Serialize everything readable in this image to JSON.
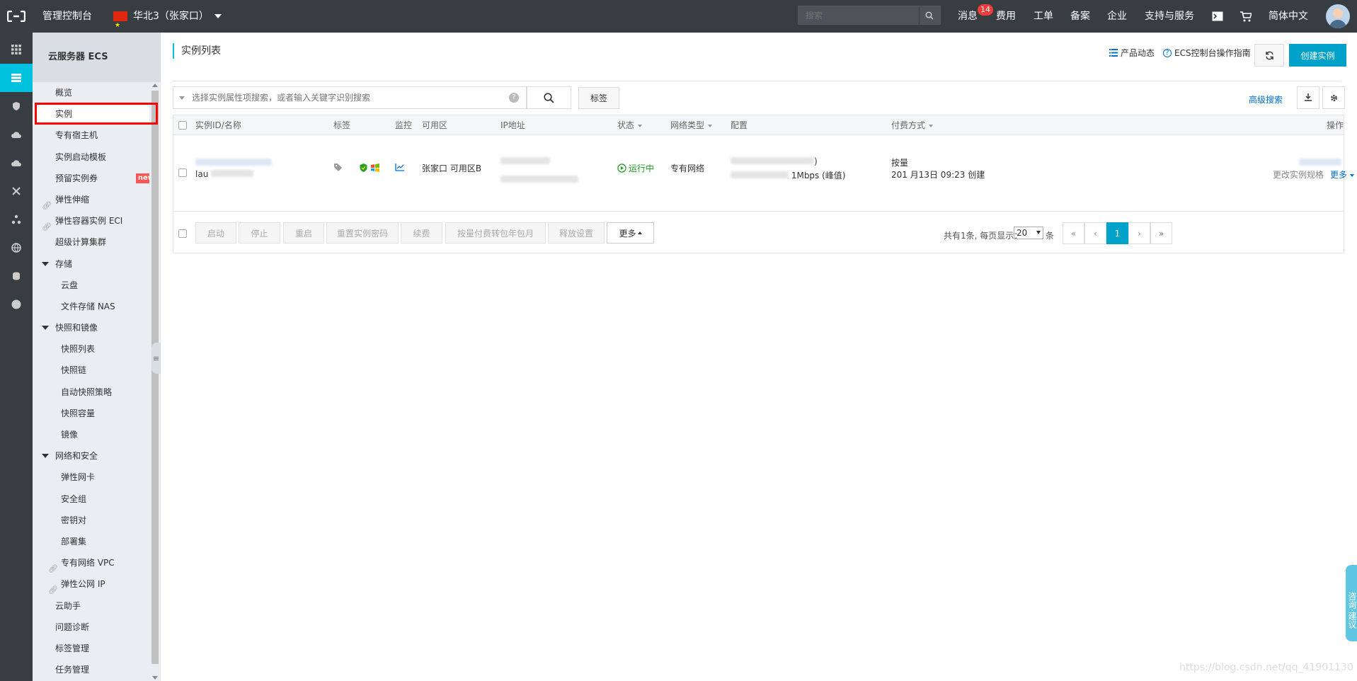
{
  "header": {
    "console_title": "管理控制台",
    "region": "华北3（张家口）",
    "search_placeholder": "搜索",
    "nav": {
      "messages": "消息",
      "messages_badge": "14",
      "billing": "费用",
      "tickets": "工单",
      "icp": "备案",
      "enterprise": "企业",
      "support": "支持与服务",
      "language": "简体中文"
    }
  },
  "sidebar": {
    "title": "云服务器 ECS",
    "items": [
      {
        "label": "概览",
        "level": 1
      },
      {
        "label": "实例",
        "level": 1,
        "active": true
      },
      {
        "label": "专有宿主机",
        "level": 1
      },
      {
        "label": "实例启动模板",
        "level": 1
      },
      {
        "label": "预留实例券",
        "level": 1,
        "badge": "new"
      },
      {
        "label": "弹性伸缩",
        "level": 1,
        "link": true
      },
      {
        "label": "弹性容器实例 ECI",
        "level": 1,
        "link": true
      },
      {
        "label": "超级计算集群",
        "level": 1
      },
      {
        "label": "存储",
        "level": 1,
        "group": true
      },
      {
        "label": "云盘",
        "level": 2
      },
      {
        "label": "文件存储 NAS",
        "level": 2
      },
      {
        "label": "快照和镜像",
        "level": 1,
        "group": true
      },
      {
        "label": "快照列表",
        "level": 2
      },
      {
        "label": "快照链",
        "level": 2
      },
      {
        "label": "自动快照策略",
        "level": 2
      },
      {
        "label": "快照容量",
        "level": 2
      },
      {
        "label": "镜像",
        "level": 2
      },
      {
        "label": "网络和安全",
        "level": 1,
        "group": true
      },
      {
        "label": "弹性网卡",
        "level": 2
      },
      {
        "label": "安全组",
        "level": 2
      },
      {
        "label": "密钥对",
        "level": 2
      },
      {
        "label": "部署集",
        "level": 2
      },
      {
        "label": "专有网络 VPC",
        "level": 2,
        "link": true
      },
      {
        "label": "弹性公网 IP",
        "level": 2,
        "link": true
      },
      {
        "label": "云助手",
        "level": 1
      },
      {
        "label": "问题诊断",
        "level": 1
      },
      {
        "label": "标签管理",
        "level": 1
      },
      {
        "label": "任务管理",
        "level": 1
      }
    ]
  },
  "page": {
    "title": "实例列表",
    "product_news": "产品动态",
    "guide": "ECS控制台操作指南",
    "create_button": "创建实例",
    "filter_placeholder": "选择实例属性项搜索，或者输入关键字识别搜索",
    "tag_button": "标签",
    "advanced_search": "高级搜索"
  },
  "table": {
    "columns": [
      "实例ID/名称",
      "标签",
      "监控",
      "可用区",
      "IP地址",
      "状态",
      "网络类型",
      "配置",
      "付费方式",
      "操作"
    ],
    "rows": [
      {
        "name_prefix": "lau",
        "zone": "张家口 可用区B",
        "status": "运行中",
        "network": "专有网络",
        "config_line1": ")",
        "config_line2": "1Mbps (峰值)",
        "billing_line1": "按量",
        "billing_line2": "201  月13日 09:23 创建",
        "op_change": "更改实例规格",
        "op_more": "更多"
      }
    ]
  },
  "actions": {
    "buttons": [
      "启动",
      "停止",
      "重启",
      "重置实例密码",
      "续费",
      "按量付费转包年包月",
      "释放设置"
    ],
    "more": "更多"
  },
  "pagination": {
    "summary": "共有1条, 每页显示：",
    "page_size": "20",
    "unit": "条",
    "current_page": "1",
    "first": "«",
    "prev": "‹",
    "next": "›",
    "last": "»"
  },
  "widgets": {
    "consult": "咨询·建议",
    "watermark": "https://blog.csdn.net/qq_41901130"
  },
  "colors": {
    "topbar": "#373d41",
    "accent": "#00c1de",
    "primary_button": "#00a2ca",
    "running": "#1e9e1e",
    "highlight_box": "#ff0000"
  }
}
